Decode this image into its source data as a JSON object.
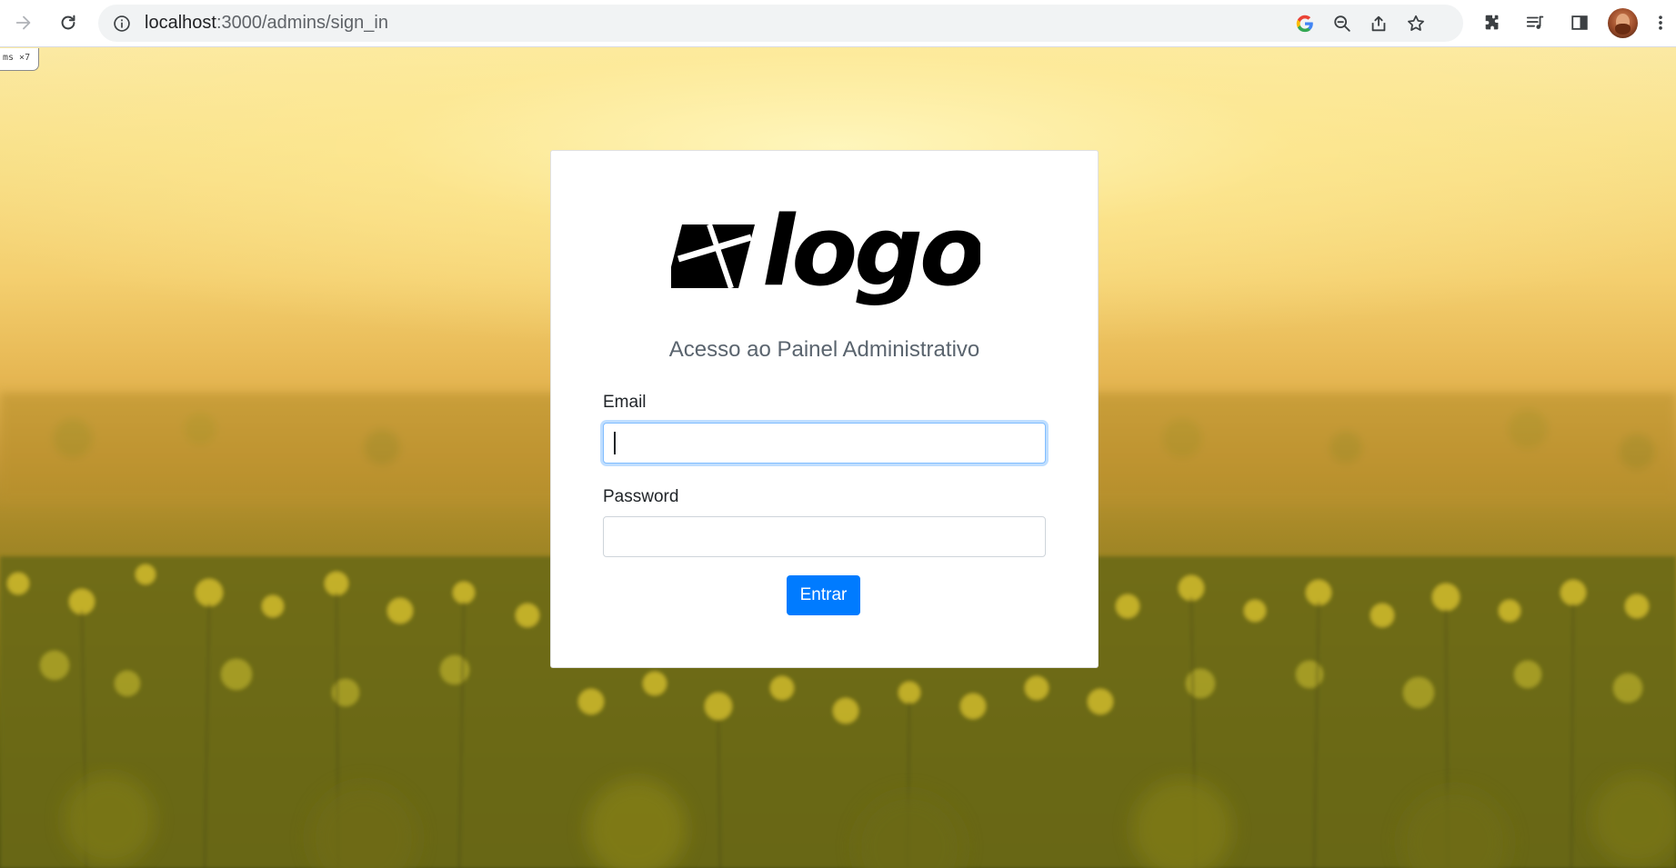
{
  "browser": {
    "url_host": "localhost",
    "url_path": ":3000/admins/sign_in",
    "icons": [
      "forward-icon",
      "reload-icon",
      "site-info-icon",
      "google-icon",
      "zoom-out-icon",
      "share-icon",
      "bookmark-star-icon",
      "extensions-icon",
      "media-queue-icon",
      "side-panel-icon",
      "profile-avatar",
      "more-menu-icon"
    ]
  },
  "dev_badge": {
    "text": "ms ×7"
  },
  "login": {
    "logo_text": "logo",
    "subtitle": "Acesso ao Painel Administrativo",
    "email_label": "Email",
    "email_value": "",
    "password_label": "Password",
    "password_value": "",
    "submit_label": "Entrar"
  },
  "colors": {
    "primary_button": "#007bff",
    "focus_ring": "#80bdff",
    "subtitle_text": "#5a646e"
  }
}
